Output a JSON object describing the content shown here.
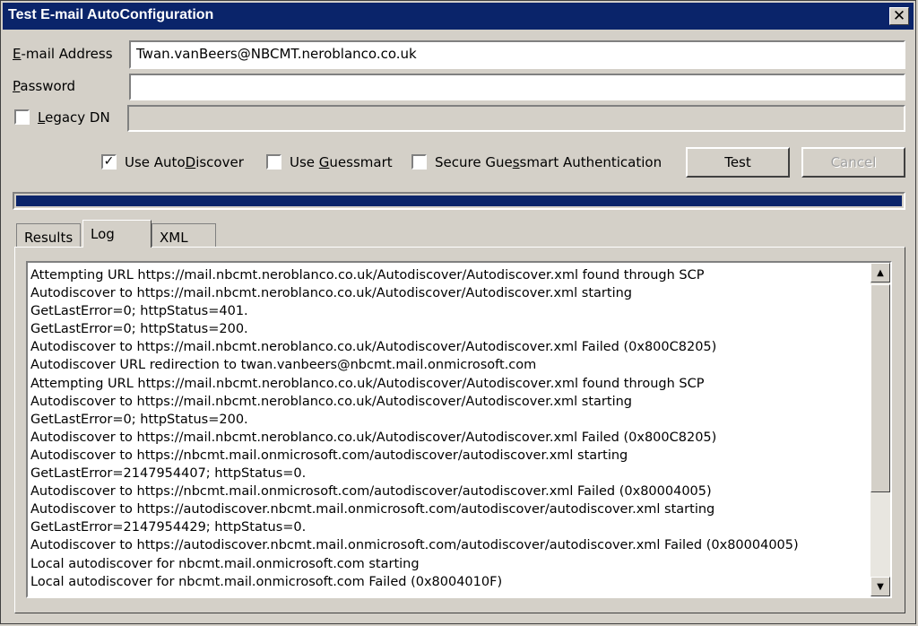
{
  "window": {
    "title": "Test E-mail AutoConfiguration",
    "close_label": "✕"
  },
  "form": {
    "email_label_u": "E",
    "email_label_rest": "-mail Address",
    "email_value": "Twan.vanBeers@NBCMT.neroblanco.co.uk",
    "password_label_u": "P",
    "password_label_rest": "assword",
    "password_value": "",
    "legacy_label_u": "L",
    "legacy_label_rest": "egacy DN",
    "legacy_checked": false,
    "legacy_value": ""
  },
  "options": {
    "autodiscover_pre": "Use Auto",
    "autodiscover_u": "D",
    "autodiscover_post": "iscover",
    "autodiscover_checked": true,
    "guessmart_pre": "Use ",
    "guessmart_u": "G",
    "guessmart_post": "uessmart",
    "guessmart_checked": false,
    "secure_pre": "Secure Gue",
    "secure_u": "s",
    "secure_post": "smart Authentication",
    "secure_checked": false
  },
  "buttons": {
    "test": "Test",
    "cancel": "Cancel"
  },
  "progress": {
    "fraction": 1.0,
    "color": "#0a246a"
  },
  "tabs": [
    {
      "label": "Results",
      "active": false
    },
    {
      "label": "Log",
      "active": true
    },
    {
      "label": "XML",
      "active": false
    }
  ],
  "log": [
    "Attempting URL https://mail.nbcmt.neroblanco.co.uk/Autodiscover/Autodiscover.xml found through SCP",
    "Autodiscover to https://mail.nbcmt.neroblanco.co.uk/Autodiscover/Autodiscover.xml starting",
    "GetLastError=0; httpStatus=401.",
    "GetLastError=0; httpStatus=200.",
    "Autodiscover to https://mail.nbcmt.neroblanco.co.uk/Autodiscover/Autodiscover.xml Failed (0x800C8205)",
    "Autodiscover URL redirection to twan.vanbeers@nbcmt.mail.onmicrosoft.com",
    "Attempting URL https://mail.nbcmt.neroblanco.co.uk/Autodiscover/Autodiscover.xml found through SCP",
    "Autodiscover to https://mail.nbcmt.neroblanco.co.uk/Autodiscover/Autodiscover.xml starting",
    "GetLastError=0; httpStatus=200.",
    "Autodiscover to https://mail.nbcmt.neroblanco.co.uk/Autodiscover/Autodiscover.xml Failed (0x800C8205)",
    "Autodiscover to https://nbcmt.mail.onmicrosoft.com/autodiscover/autodiscover.xml starting",
    "GetLastError=2147954407; httpStatus=0.",
    "Autodiscover to https://nbcmt.mail.onmicrosoft.com/autodiscover/autodiscover.xml Failed (0x80004005)",
    "Autodiscover to https://autodiscover.nbcmt.mail.onmicrosoft.com/autodiscover/autodiscover.xml starting",
    "GetLastError=2147954429; httpStatus=0.",
    "Autodiscover to https://autodiscover.nbcmt.mail.onmicrosoft.com/autodiscover/autodiscover.xml Failed (0x80004005)",
    "Local autodiscover for nbcmt.mail.onmicrosoft.com starting",
    "Local autodiscover for nbcmt.mail.onmicrosoft.com Failed (0x8004010F)"
  ],
  "scrollbar": {
    "up_icon": "▲",
    "down_icon": "▼"
  }
}
